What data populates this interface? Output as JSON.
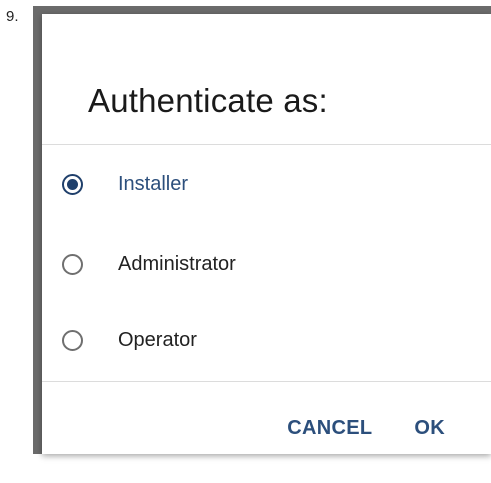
{
  "step": {
    "number": "9."
  },
  "dialog": {
    "title": "Authenticate as:",
    "options": [
      {
        "label": "Installer",
        "selected": true
      },
      {
        "label": "Administrator",
        "selected": false
      },
      {
        "label": "Operator",
        "selected": false
      }
    ],
    "cancel_label": "CANCEL",
    "ok_label": "OK"
  },
  "colors": {
    "accent": "#2c4f7c",
    "radio_checked": "#1f3f6b",
    "radio_unchecked": "#6f6f6f",
    "backdrop": "#6b6b6b"
  }
}
